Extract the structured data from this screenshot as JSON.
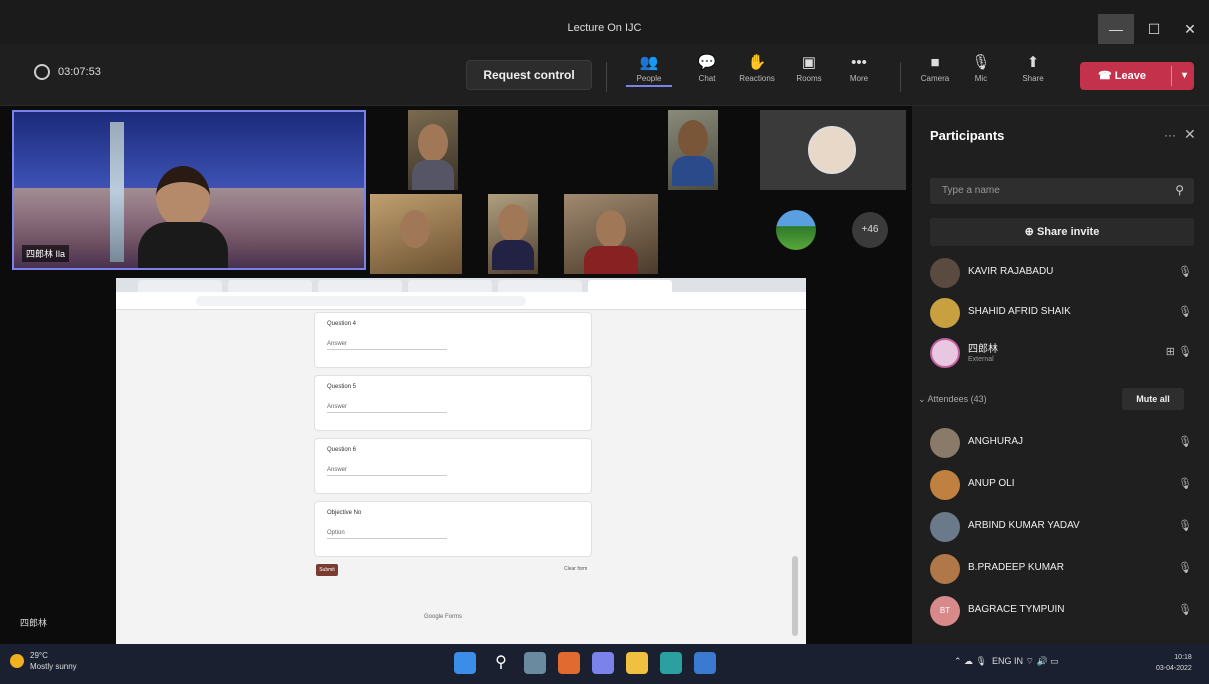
{
  "window": {
    "title": "Lecture On IJC",
    "minimize": "—",
    "maximize": "☐",
    "close": "✕"
  },
  "toolbar": {
    "timer": "03:07:53",
    "request_control": "Request control",
    "items": [
      {
        "icon": "people-icon",
        "glyph": "👥",
        "label": "People"
      },
      {
        "icon": "chat-icon",
        "glyph": "💬",
        "label": "Chat"
      },
      {
        "icon": "reactions-icon",
        "glyph": "✋",
        "label": "Reactions"
      },
      {
        "icon": "rooms-icon",
        "glyph": "▣",
        "label": "Rooms"
      },
      {
        "icon": "more-icon",
        "glyph": "•••",
        "label": "More"
      },
      {
        "icon": "camera-icon",
        "glyph": "■",
        "label": "Camera"
      },
      {
        "icon": "mic-off-icon",
        "glyph": "🎙",
        "label": "Mic"
      },
      {
        "icon": "share-icon",
        "glyph": "⬆",
        "label": "Share"
      }
    ],
    "leave": "Leave"
  },
  "stage": {
    "main_tag": "四郎林 Ila",
    "bottom_tag": "四郎林",
    "more_count": "+46"
  },
  "shared_form": {
    "cards": [
      {
        "question": "Question 4",
        "answer": "Answer"
      },
      {
        "question": "Question 5",
        "answer": "Answer"
      },
      {
        "question": "Question 6",
        "answer": "Answer"
      },
      {
        "question": "Objective No",
        "answer": "Option"
      }
    ],
    "submit": "Submit",
    "clear": "Clear form",
    "footer": "Google Forms"
  },
  "participants": {
    "title": "Participants",
    "more": "···",
    "close": "✕",
    "search_placeholder": "Type a name",
    "share_invite": "Share invite",
    "presenters": [
      {
        "name": "KAVIR RAJABADU",
        "sub": ""
      },
      {
        "name": "SHAHID AFRID SHAIK",
        "sub": ""
      },
      {
        "name": "四郎林",
        "sub": "External"
      }
    ],
    "attendees_label": "Attendees (43)",
    "mute_all": "Mute all",
    "attendees": [
      {
        "name": "ANGHURAJ"
      },
      {
        "name": "ANUP OLI"
      },
      {
        "name": "ARBIND KUMAR YADAV"
      },
      {
        "name": "B.PRADEEP KUMAR"
      },
      {
        "name": "BAGRACE TYMPUIN",
        "initials": "BT"
      }
    ]
  },
  "taskbar": {
    "temp": "29°C",
    "weather": "Mostly sunny",
    "lang1": "ENG",
    "lang2": "IN",
    "time": "10:18",
    "date": "03-04-2022"
  }
}
